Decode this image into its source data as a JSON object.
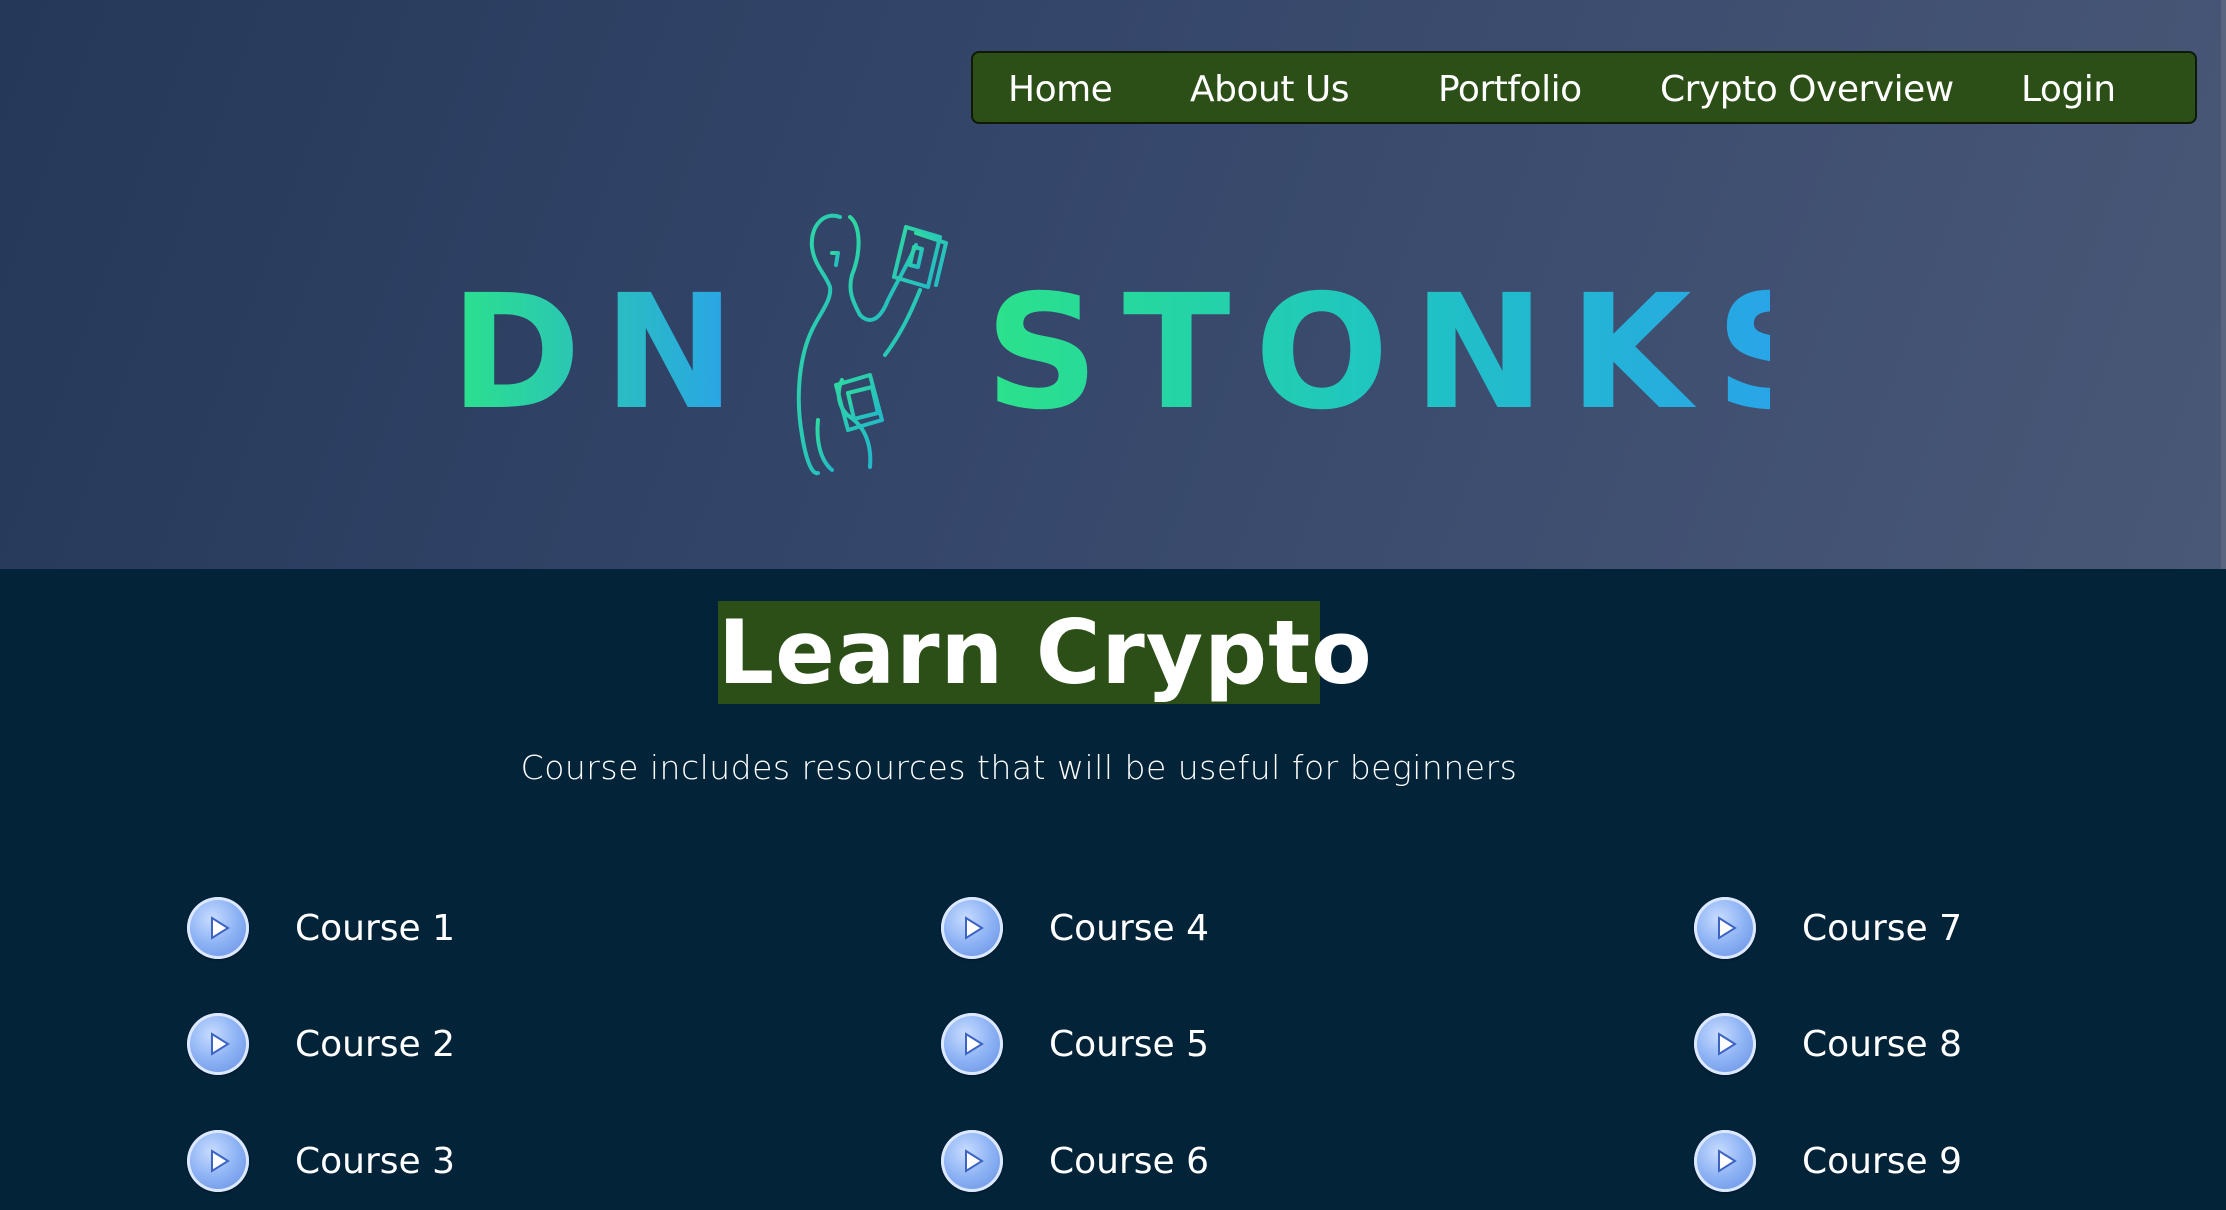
{
  "nav": {
    "items": [
      "Home",
      "About Us",
      "Portfolio",
      "Crypto Overview",
      "Login"
    ]
  },
  "logo": {
    "left_text": "DN",
    "right_text": "STONKS",
    "icon": "person-holding-cards-icon",
    "gradient": [
      "#2be28a",
      "#1fc6c0",
      "#2a9ef0"
    ]
  },
  "main": {
    "title": "Learn Crypto",
    "subtitle": "Course includes resources that will be useful for beginners",
    "courses": [
      "Course 1",
      "Course 2",
      "Course 3",
      "Course 4",
      "Course 5",
      "Course 6",
      "Course 7",
      "Course 8",
      "Course 9"
    ]
  },
  "colors": {
    "nav_bg": "#2c4f18",
    "content_bg": "#032338",
    "title_bg": "#2c4f18",
    "play_icon": "#8fb4f5"
  }
}
